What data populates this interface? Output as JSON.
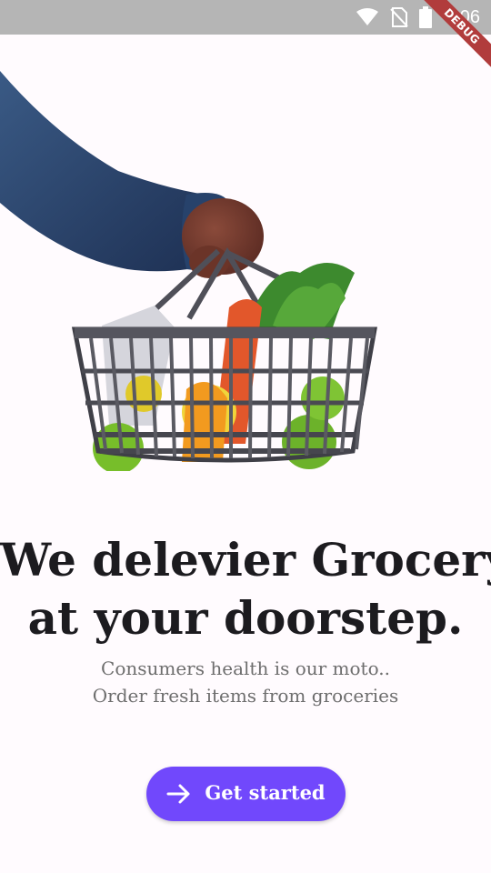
{
  "status_bar": {
    "time": "3:06",
    "icons": [
      "wifi-icon",
      "no-sim-icon",
      "battery-icon"
    ],
    "background": "#b5b5b5"
  },
  "debug_banner": {
    "label": "DEBUG",
    "color": "#b13c3c"
  },
  "hero": {
    "image": "hand-holding-grocery-basket-illustration"
  },
  "headline": {
    "line1": "We delevier Grocery",
    "line2": "at your doorstep."
  },
  "subtitle": {
    "line1": "Consumers health is our moto..",
    "line2": "Order fresh items from groceries"
  },
  "cta": {
    "label": "Get started",
    "icon": "arrow-right-icon",
    "color": "#7148fc"
  }
}
